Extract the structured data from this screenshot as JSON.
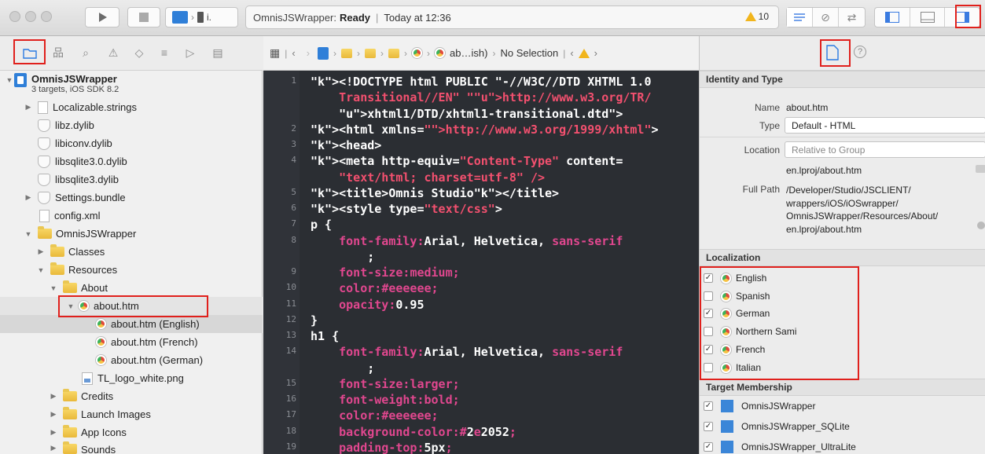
{
  "toolbar": {
    "scheme_target": "i.",
    "activity": {
      "project": "OmnisJSWrapper:",
      "status": "Ready",
      "time": "Today at 12:36"
    },
    "warnings": "10"
  },
  "navigator": {
    "items": [
      {
        "label": "OmnisJSWrapper",
        "sub": "3 targets, iOS SDK 8.2"
      },
      {
        "label": "Localizable.strings"
      },
      {
        "label": "libz.dylib"
      },
      {
        "label": "libiconv.dylib"
      },
      {
        "label": "libsqlite3.0.dylib"
      },
      {
        "label": "libsqlite3.dylib"
      },
      {
        "label": "Settings.bundle"
      },
      {
        "label": "config.xml"
      },
      {
        "label": "OmnisJSWrapper"
      },
      {
        "label": "Classes"
      },
      {
        "label": "Resources"
      },
      {
        "label": "About"
      },
      {
        "label": "about.htm"
      },
      {
        "label": "about.htm (English)"
      },
      {
        "label": "about.htm (French)"
      },
      {
        "label": "about.htm (German)"
      },
      {
        "label": "TL_logo_white.png"
      },
      {
        "label": "Credits"
      },
      {
        "label": "Launch Images"
      },
      {
        "label": "App Icons"
      },
      {
        "label": "Sounds"
      }
    ]
  },
  "editor": {
    "jump_bar": {
      "file": "ab…ish)",
      "selection": "No Selection"
    },
    "lines": [
      {
        "n": "1",
        "t": "<!DOCTYPE html PUBLIC \"-//W3C//DTD XHTML 1.0"
      },
      {
        "n": "",
        "t": "    Transitional//EN\" \"http://www.w3.org/TR/"
      },
      {
        "n": "",
        "t": "    xhtml1/DTD/xhtml1-transitional.dtd\">"
      },
      {
        "n": "2",
        "t": "<html xmlns=\"http://www.w3.org/1999/xhtml\">"
      },
      {
        "n": "3",
        "t": "<head>"
      },
      {
        "n": "4",
        "t": "<meta http-equiv=\"Content-Type\" content="
      },
      {
        "n": "",
        "t": "    \"text/html; charset=utf-8\" />"
      },
      {
        "n": "5",
        "t": "<title>Omnis Studio</title>"
      },
      {
        "n": "6",
        "t": "<style type=\"text/css\">"
      },
      {
        "n": "7",
        "t": "p {"
      },
      {
        "n": "8",
        "t": "    font-family:Arial, Helvetica, sans-serif"
      },
      {
        "n": "",
        "t": "        ;"
      },
      {
        "n": "9",
        "t": "    font-size:medium;"
      },
      {
        "n": "10",
        "t": "    color:#eeeeee;"
      },
      {
        "n": "11",
        "t": "    opacity:0.95"
      },
      {
        "n": "12",
        "t": "}"
      },
      {
        "n": "13",
        "t": "h1 {"
      },
      {
        "n": "14",
        "t": "    font-family:Arial, Helvetica, sans-serif"
      },
      {
        "n": "",
        "t": "        ;"
      },
      {
        "n": "15",
        "t": "    font-size:larger;"
      },
      {
        "n": "16",
        "t": "    font-weight:bold;"
      },
      {
        "n": "17",
        "t": "    color:#eeeeee;"
      },
      {
        "n": "18",
        "t": "    background-color:#2e2052;"
      },
      {
        "n": "19",
        "t": "    padding-top:5px;"
      }
    ]
  },
  "inspector": {
    "identity": {
      "title": "Identity and Type",
      "name_label": "Name",
      "name_value": "about.htm",
      "type_label": "Type",
      "type_value": "Default - HTML",
      "location_label": "Location",
      "location_value": "Relative to Group",
      "location_path": "en.lproj/about.htm",
      "fullpath_label": "Full Path",
      "fullpath_lines": [
        "/Developer/Studio/JSCLIENT/",
        "wrappers/iOS/iOSwrapper/",
        "OmnisJSWrapper/Resources/About/",
        "en.lproj/about.htm"
      ]
    },
    "localization": {
      "title": "Localization",
      "items": [
        {
          "label": "English",
          "checked": "✓"
        },
        {
          "label": "Spanish",
          "checked": ""
        },
        {
          "label": "German",
          "checked": "✓"
        },
        {
          "label": "Northern Sami",
          "checked": ""
        },
        {
          "label": "French",
          "checked": "✓"
        },
        {
          "label": "Italian",
          "checked": ""
        }
      ]
    },
    "target_membership": {
      "title": "Target Membership",
      "items": [
        {
          "label": "OmnisJSWrapper",
          "checked": "✓"
        },
        {
          "label": "OmnisJSWrapper_SQLite",
          "checked": "✓"
        },
        {
          "label": "OmnisJSWrapper_UltraLite",
          "checked": "✓"
        }
      ]
    }
  },
  "colors": {
    "highlight_red": "#e0201c",
    "editor_bg": "#2b2e33",
    "keyword_pink": "#e1478f",
    "link_blue": "#5d7bf3"
  }
}
